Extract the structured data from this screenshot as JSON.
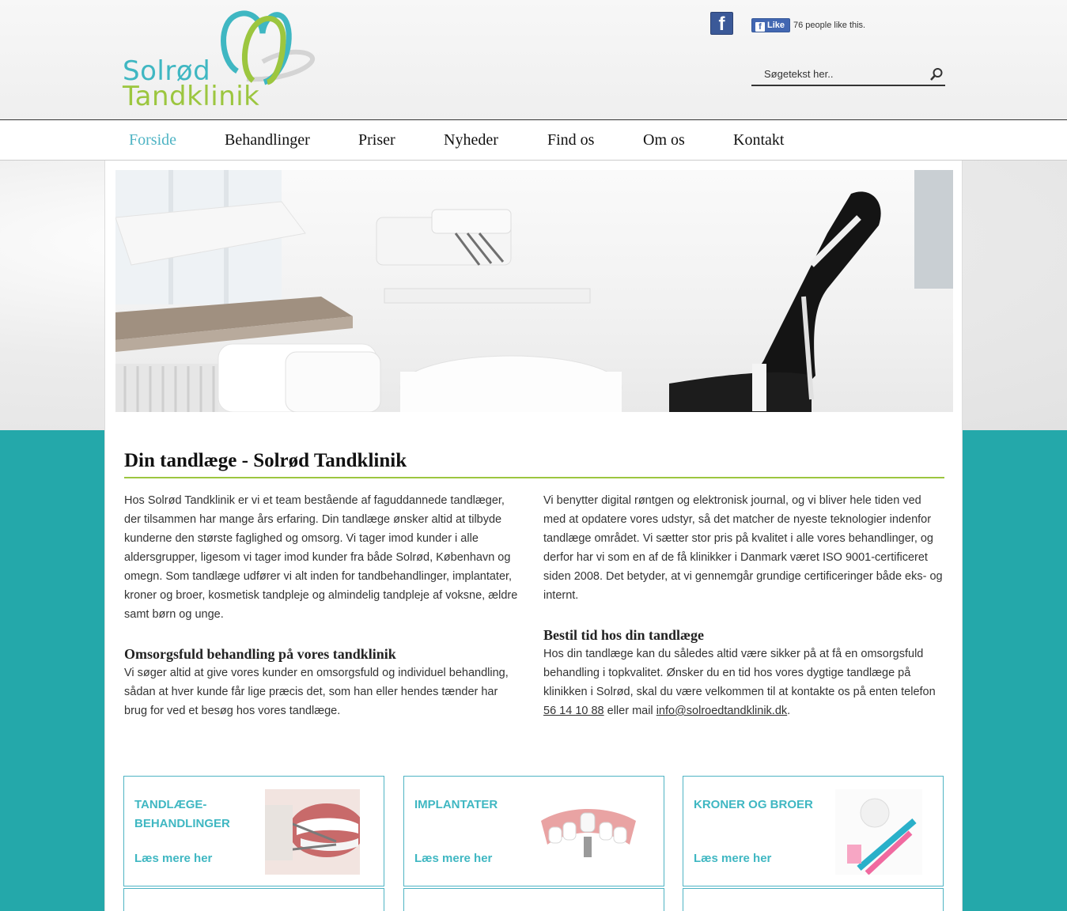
{
  "brand": {
    "line1": "Solrød",
    "line2": "Tandklinik",
    "teal": "#3fb7c2",
    "green": "#9cc63f"
  },
  "social": {
    "facebook_icon": "facebook-icon",
    "like_label": "Like",
    "like_count": "76 people like this."
  },
  "search": {
    "placeholder": "Søgetekst her.."
  },
  "nav": {
    "items": [
      {
        "label": "Forside"
      },
      {
        "label": "Behandlinger"
      },
      {
        "label": "Priser"
      },
      {
        "label": "Nyheder"
      },
      {
        "label": "Find os"
      },
      {
        "label": "Om os"
      },
      {
        "label": "Kontakt"
      }
    ]
  },
  "main": {
    "title": "Din tandlæge - Solrød Tandklinik",
    "left": {
      "p1": "Hos Solrød Tandklinik er vi et team bestående af faguddannede tandlæger, der tilsammen har mange års erfaring. Din tandlæge ønsker altid at tilbyde kunderne den største faglighed og omsorg. Vi tager imod kunder i alle aldersgrupper, ligesom vi tager imod kunder fra både Solrød, København og omegn. Som tandlæge udfører vi alt inden for tandbehandlinger, implantater, kroner og broer, kosmetisk tandpleje og almindelig tandpleje af voksne, ældre samt børn og unge.",
      "h2": "Omsorgsfuld behandling på vores tandklinik",
      "p2": "Vi søger altid at give vores kunder en omsorgsfuld og individuel behandling, sådan at hver kunde får lige præcis det, som han eller hendes tænder har brug for ved et besøg hos vores tandlæge."
    },
    "right": {
      "p1": "Vi benytter digital røntgen og elektronisk journal, og vi bliver hele tiden ved med at opdatere vores udstyr, så det matcher de nyeste teknologier indenfor tandlæge området. Vi sætter stor pris på kvalitet i alle vores behandlinger, og derfor har vi som en af de få klinikker i Danmark været ISO 9001-certificeret siden 2008. Det betyder, at vi gennemgår grundige certificeringer både eks- og internt.",
      "h2": "Bestil tid hos din tandlæge",
      "p2": "Hos din tandlæge kan du således altid være sikker på at få en omsorgsfuld behandling i topkvalitet. Ønsker du en tid hos vores dygtige tandlæge på klinikken i Solrød, skal du være velkommen til at kontakte os på enten telefon",
      "phone": "56 14 10 88",
      "or_mail": "eller mail",
      "email": "info@solroedtandklinik.dk",
      "end": "."
    }
  },
  "boxes": [
    {
      "title": "Tandlæge-behandlinger",
      "link": "Læs mere her"
    },
    {
      "title": "Implantater",
      "link": "Læs mere her"
    },
    {
      "title": "Kroner og broer",
      "link": "Læs mere her"
    }
  ]
}
